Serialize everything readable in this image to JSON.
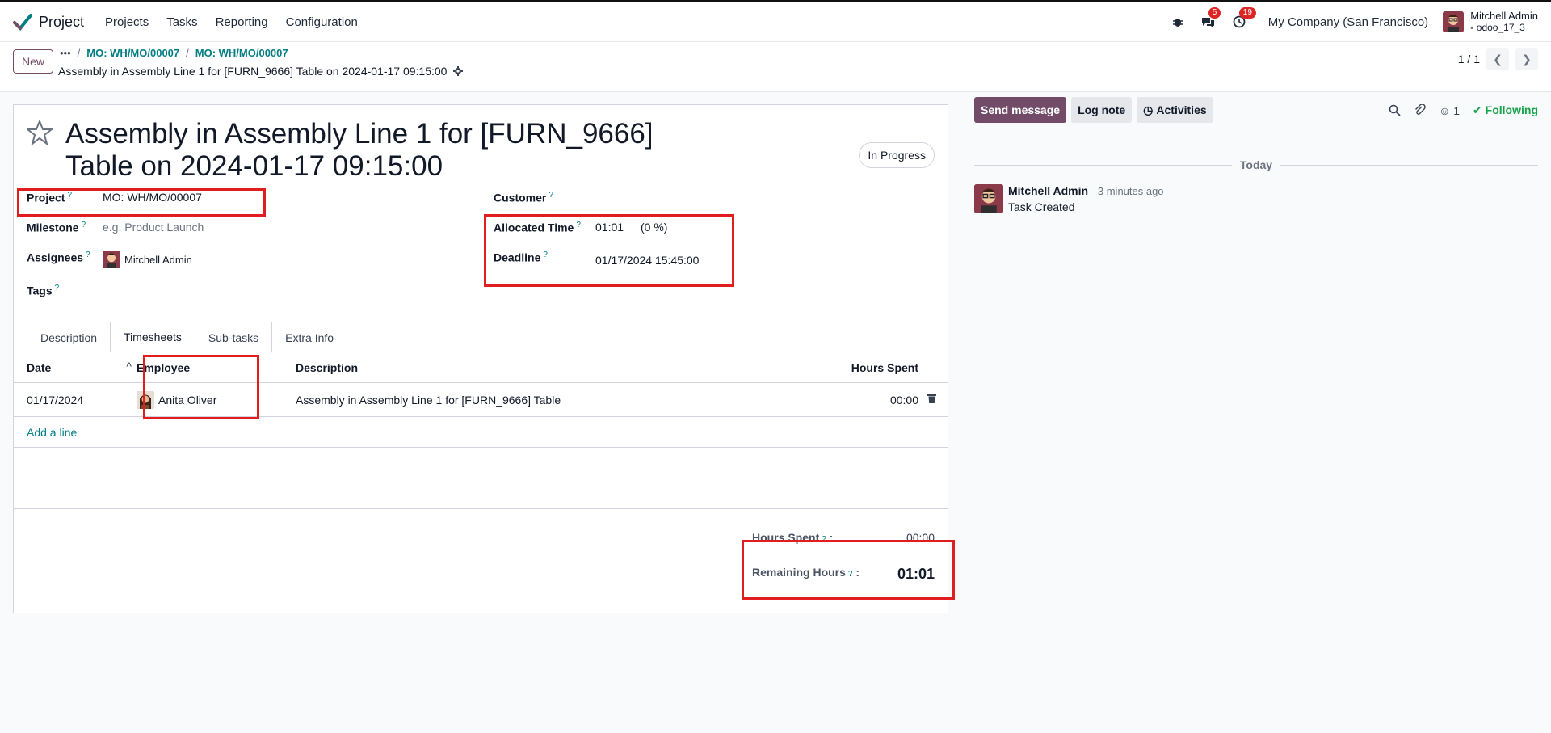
{
  "app": {
    "name": "Project",
    "menu": [
      "Projects",
      "Tasks",
      "Reporting",
      "Configuration"
    ],
    "messages_badge": "5",
    "activities_badge": "19",
    "company": "My Company (San Francisco)",
    "user_name": "Mitchell Admin",
    "db_name": "odoo_17_3"
  },
  "control": {
    "new_label": "New",
    "breadcrumb_more": "•••",
    "breadcrumb_1": "MO: WH/MO/00007",
    "breadcrumb_2": "MO: WH/MO/00007",
    "record_title": "Assembly in Assembly Line 1 for [FURN_9666] Table on 2024-01-17 09:15:00",
    "pager": "1 / 1"
  },
  "task": {
    "title": "Assembly in Assembly Line 1 for [FURN_9666] Table on 2024-01-17 09:15:00",
    "state": "In Progress",
    "help_mark": "?",
    "project_label": "Project",
    "project_value": "MO: WH/MO/00007",
    "milestone_label": "Milestone",
    "milestone_placeholder": "e.g. Product Launch",
    "assignees_label": "Assignees",
    "assignee_name": "Mitchell Admin",
    "tags_label": "Tags",
    "customer_label": "Customer",
    "allocated_label": "Allocated Time",
    "allocated_value": "01:01",
    "allocated_percent": "(0 %)",
    "deadline_label": "Deadline",
    "deadline_value": "01/17/2024 15:45:00"
  },
  "tabs": [
    "Description",
    "Timesheets",
    "Sub-tasks",
    "Extra Info"
  ],
  "timesheets": {
    "headers": {
      "date": "Date",
      "employee": "Employee",
      "description": "Description",
      "hours": "Hours Spent"
    },
    "rows": [
      {
        "date": "01/17/2024",
        "employee": "Anita Oliver",
        "description": "Assembly in Assembly Line 1 for [FURN_9666] Table",
        "hours": "00:00"
      }
    ],
    "add_line": "Add a line",
    "hours_spent_label": "Hours Spent",
    "hours_spent_value": "00:00",
    "remaining_label": "Remaining Hours",
    "remaining_value": "01:01"
  },
  "chatter": {
    "send_message": "Send message",
    "log_note": "Log note",
    "activities": "Activities",
    "followers_count": "1",
    "following": "Following",
    "day_separator": "Today",
    "message_author": "Mitchell Admin",
    "message_time": "- 3 minutes ago",
    "message_body": "Task Created"
  },
  "colors": {
    "brand": "#714B67",
    "link": "#017e84",
    "annotation": "#e11d1d"
  }
}
